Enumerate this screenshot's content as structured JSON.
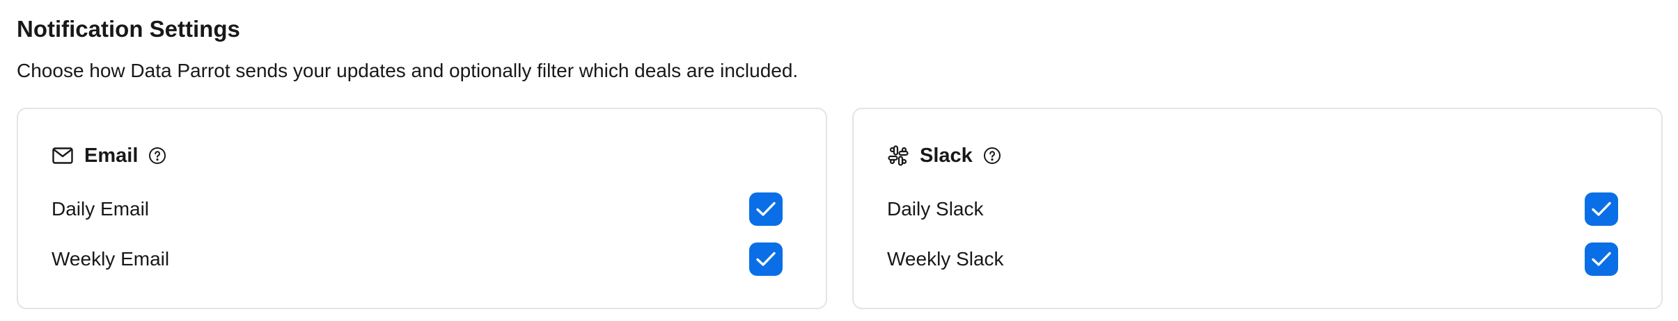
{
  "header": {
    "title": "Notification Settings",
    "subtitle": "Choose how Data Parrot sends your updates and optionally filter which deals are included."
  },
  "colors": {
    "accent": "#0a6fe6",
    "card_border": "#e4e4e7",
    "text": "#18181b"
  },
  "cards": [
    {
      "title": "Email",
      "icon": "mail-icon",
      "help_icon": "help-circle-icon",
      "options": [
        {
          "label": "Daily Email",
          "checked": true
        },
        {
          "label": "Weekly Email",
          "checked": true
        }
      ]
    },
    {
      "title": "Slack",
      "icon": "slack-icon",
      "help_icon": "help-circle-icon",
      "options": [
        {
          "label": "Daily Slack",
          "checked": true
        },
        {
          "label": "Weekly Slack",
          "checked": true
        }
      ]
    }
  ]
}
